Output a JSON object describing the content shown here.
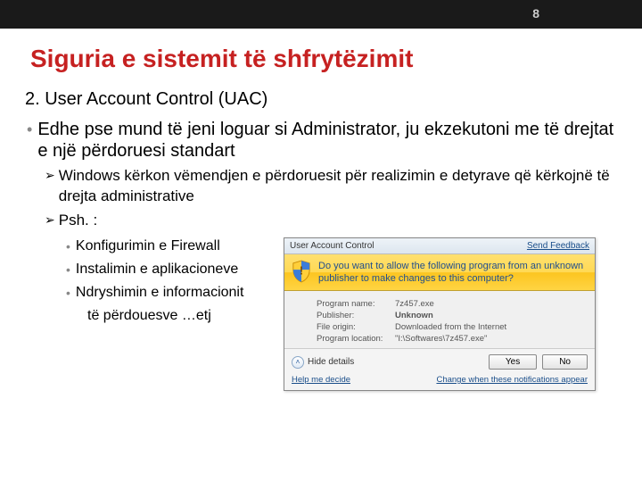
{
  "page_number": "8",
  "title": "Siguria e sistemit të shfrytëzimit",
  "sub": "2. User Account Control (UAC)",
  "bullet1": "Edhe pse mund të jeni loguar si Administrator, ju ekzekutoni me të drejtat e një përdoruesi standart",
  "arrow1": "Windows kërkon vëmendjen e përdoruesit për realizimin e detyrave që kërkojnë të drejta administrative",
  "arrow2": "Psh. :",
  "exlist": [
    "Konfigurimin e Firewall",
    "Instalimin e aplikacioneve",
    "Ndryshimin e informacionit",
    "të përdouesve …etj"
  ],
  "dialog": {
    "title": "User Account Control",
    "feedback": "Send Feedback",
    "header": "Do you want to allow the following program from an unknown publisher to make changes to this computer?",
    "rows": {
      "prog_k": "Program name:",
      "prog_v": "7z457.exe",
      "pub_k": "Publisher:",
      "pub_v": "Unknown",
      "orig_k": "File origin:",
      "orig_v": "Downloaded from the Internet",
      "loc_k": "Program location:",
      "loc_v": "\"I:\\Softwares\\7z457.exe\""
    },
    "hide": "Hide details",
    "yes": "Yes",
    "no": "No",
    "help": "Help me decide",
    "change": "Change when these notifications appear"
  }
}
